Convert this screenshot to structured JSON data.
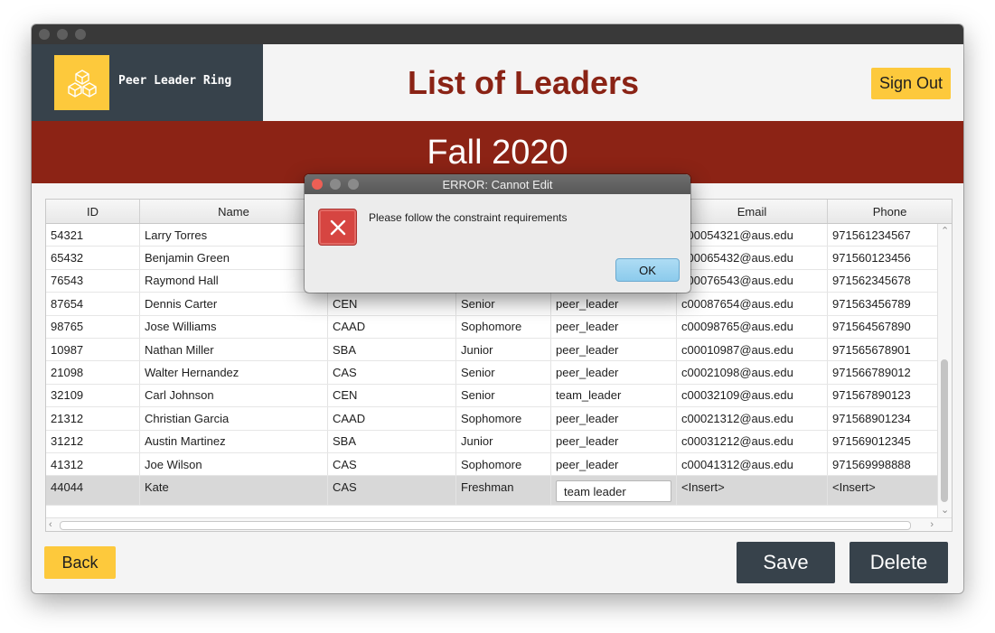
{
  "brand": {
    "name": "Peer Leader Ring",
    "logo": "cubes-icon",
    "logo_color": "#fdc93c"
  },
  "header": {
    "title": "List of Leaders",
    "sign_out_label": "Sign Out"
  },
  "banner": {
    "term": "Fall 2020"
  },
  "table": {
    "columns": [
      "ID",
      "Name",
      "",
      "",
      "",
      "Email",
      "Phone"
    ],
    "rows": [
      [
        "54321",
        "Larry Torres",
        "",
        "",
        "",
        "c00054321@aus.edu",
        "971561234567"
      ],
      [
        "65432",
        "Benjamin Green",
        "",
        "",
        "",
        "c00065432@aus.edu",
        "971560123456"
      ],
      [
        "76543",
        "Raymond Hall",
        "",
        "",
        "",
        "c00076543@aus.edu",
        "971562345678"
      ],
      [
        "87654",
        "Dennis Carter",
        "CEN",
        "Senior",
        "peer_leader",
        "c00087654@aus.edu",
        "971563456789"
      ],
      [
        "98765",
        "Jose Williams",
        "CAAD",
        "Sophomore",
        "peer_leader",
        "c00098765@aus.edu",
        "971564567890"
      ],
      [
        "10987",
        "Nathan Miller",
        "SBA",
        "Junior",
        "peer_leader",
        "c00010987@aus.edu",
        "971565678901"
      ],
      [
        "21098",
        "Walter Hernandez",
        "CAS",
        "Senior",
        "peer_leader",
        "c00021098@aus.edu",
        "971566789012"
      ],
      [
        "32109",
        "Carl Johnson",
        "CEN",
        "Senior",
        "team_leader",
        "c00032109@aus.edu",
        "971567890123"
      ],
      [
        "21312",
        "Christian Garcia",
        "CAAD",
        "Sophomore",
        "peer_leader",
        "c00021312@aus.edu",
        "971568901234"
      ],
      [
        "31212",
        "Austin Martinez",
        "SBA",
        "Junior",
        "peer_leader",
        "c00031212@aus.edu",
        "971569012345"
      ],
      [
        "41312",
        "Joe Wilson",
        "CAS",
        "Sophomore",
        "peer_leader",
        "c00041312@aus.edu",
        "971569998888"
      ]
    ],
    "editing_row": {
      "id": "44044",
      "name": "Kate",
      "college": "CAS",
      "year": "Freshman",
      "role_value": "team leader",
      "email": "<Insert>",
      "phone": "<Insert>"
    }
  },
  "footer": {
    "back_label": "Back",
    "save_label": "Save",
    "delete_label": "Delete"
  },
  "dialog": {
    "title": "ERROR: Cannot Edit",
    "message": "Please follow the constraint requirements",
    "ok_label": "OK",
    "icon": "error-x-icon"
  },
  "colors": {
    "accent_yellow": "#fdc93c",
    "brand_dark": "#37424b",
    "banner_red": "#8c2315",
    "title_red": "#8a2315"
  }
}
